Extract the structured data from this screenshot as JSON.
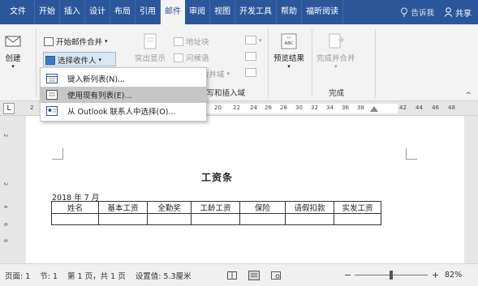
{
  "tabs": [
    "文件",
    "开始",
    "插入",
    "设计",
    "布局",
    "引用",
    "邮件",
    "审阅",
    "视图",
    "开发工具",
    "帮助",
    "福昕阅读"
  ],
  "active_tab": "邮件",
  "tell_me": "告诉我",
  "share": "共享",
  "ribbon": {
    "create": "创建",
    "start_merge": "开始邮件合并",
    "select_recipients": "选择收件人",
    "address_block": "地址块",
    "greeting": "问候语",
    "insert_field": "插入合并域",
    "highlight_partial": "突出显示",
    "write_insert_group": "编写和插入域",
    "preview_results": "预览结果",
    "finish_merge": "完成并合并",
    "finish_group": "完成",
    "preview_icon_text": "ABC"
  },
  "menu": {
    "items": [
      {
        "label": "键入新列表(N)..."
      },
      {
        "label": "使用现有列表(E)..."
      },
      {
        "label": "从 Outlook 联系人中选择(O)..."
      }
    ]
  },
  "ruler": {
    "ticks": [
      "2",
      "20",
      "22",
      "24",
      "26",
      "28",
      "30",
      "32",
      "34",
      "36",
      "38",
      "42",
      "44",
      "46",
      "48"
    ],
    "left_marker": "L"
  },
  "vruler": [
    "2",
    "2",
    "4",
    "6",
    "8"
  ],
  "document": {
    "title": "工资条",
    "date": "2018 年 7 月",
    "table_headers": [
      "姓名",
      "基本工资",
      "全勤奖",
      "工龄工资",
      "保险",
      "请假扣款",
      "实发工资"
    ]
  },
  "status": {
    "page": "页面: 1",
    "section": "节: 1",
    "pages": "第 1 页，共 1 页",
    "setting": "设置值: 5.3厘米",
    "zoom": "82%",
    "zoom_level": 0.82
  },
  "colors": {
    "accent": "#2b579a",
    "ribbon_bg": "#f3f3f3"
  }
}
